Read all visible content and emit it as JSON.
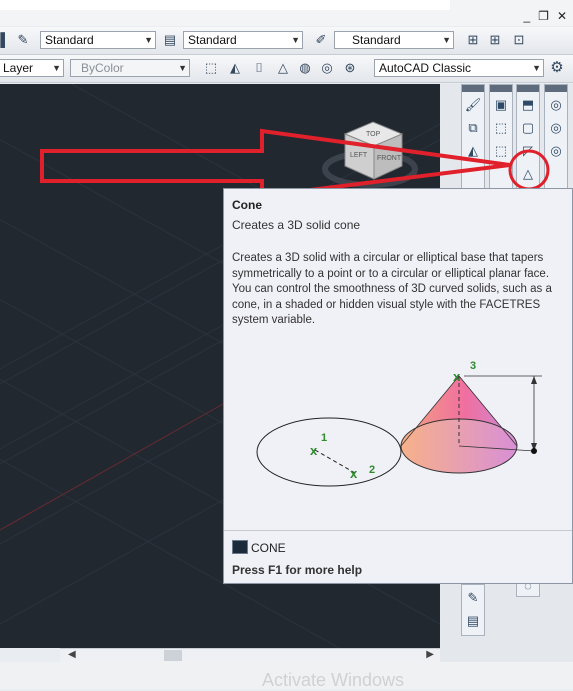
{
  "window": {
    "controls": [
      "_",
      "❐",
      "✕"
    ]
  },
  "toolbar1": {
    "text_style": "Standard",
    "dim_style": "Standard",
    "multileader_style": "Standard"
  },
  "toolbar2": {
    "layer": "Layer",
    "color": "ByColor",
    "workspace": "AutoCAD Classic"
  },
  "viewcube": {
    "top": "TOP",
    "left": "LEFT",
    "front": "FRONT"
  },
  "tooltip": {
    "title": "Cone",
    "subtitle": "Creates a 3D solid cone",
    "description": "Creates a 3D solid with a circular or elliptical base that tapers symmetrically to a point or to a circular or elliptical planar face. You can control the smoothness of 3D curved solids, such as a cone, in a shaded or hidden visual style with the FACETRES system variable.",
    "illustration_labels": [
      "1",
      "2",
      "3"
    ],
    "command": "CONE",
    "help": "Press F1 for more help"
  },
  "watermark": "Activate Windows",
  "colors": {
    "highlight_red": "#e0202a",
    "canvas": "#212830",
    "marker_green": "#2e8b2e"
  },
  "icons": [
    "text-style-icon",
    "dim-style-icon",
    "multileader-icon",
    "box-icon",
    "wedge-icon",
    "cylinder-icon",
    "sphere-icon",
    "torus-icon",
    "pyramid-icon",
    "cone-icon",
    "gear-icon"
  ]
}
